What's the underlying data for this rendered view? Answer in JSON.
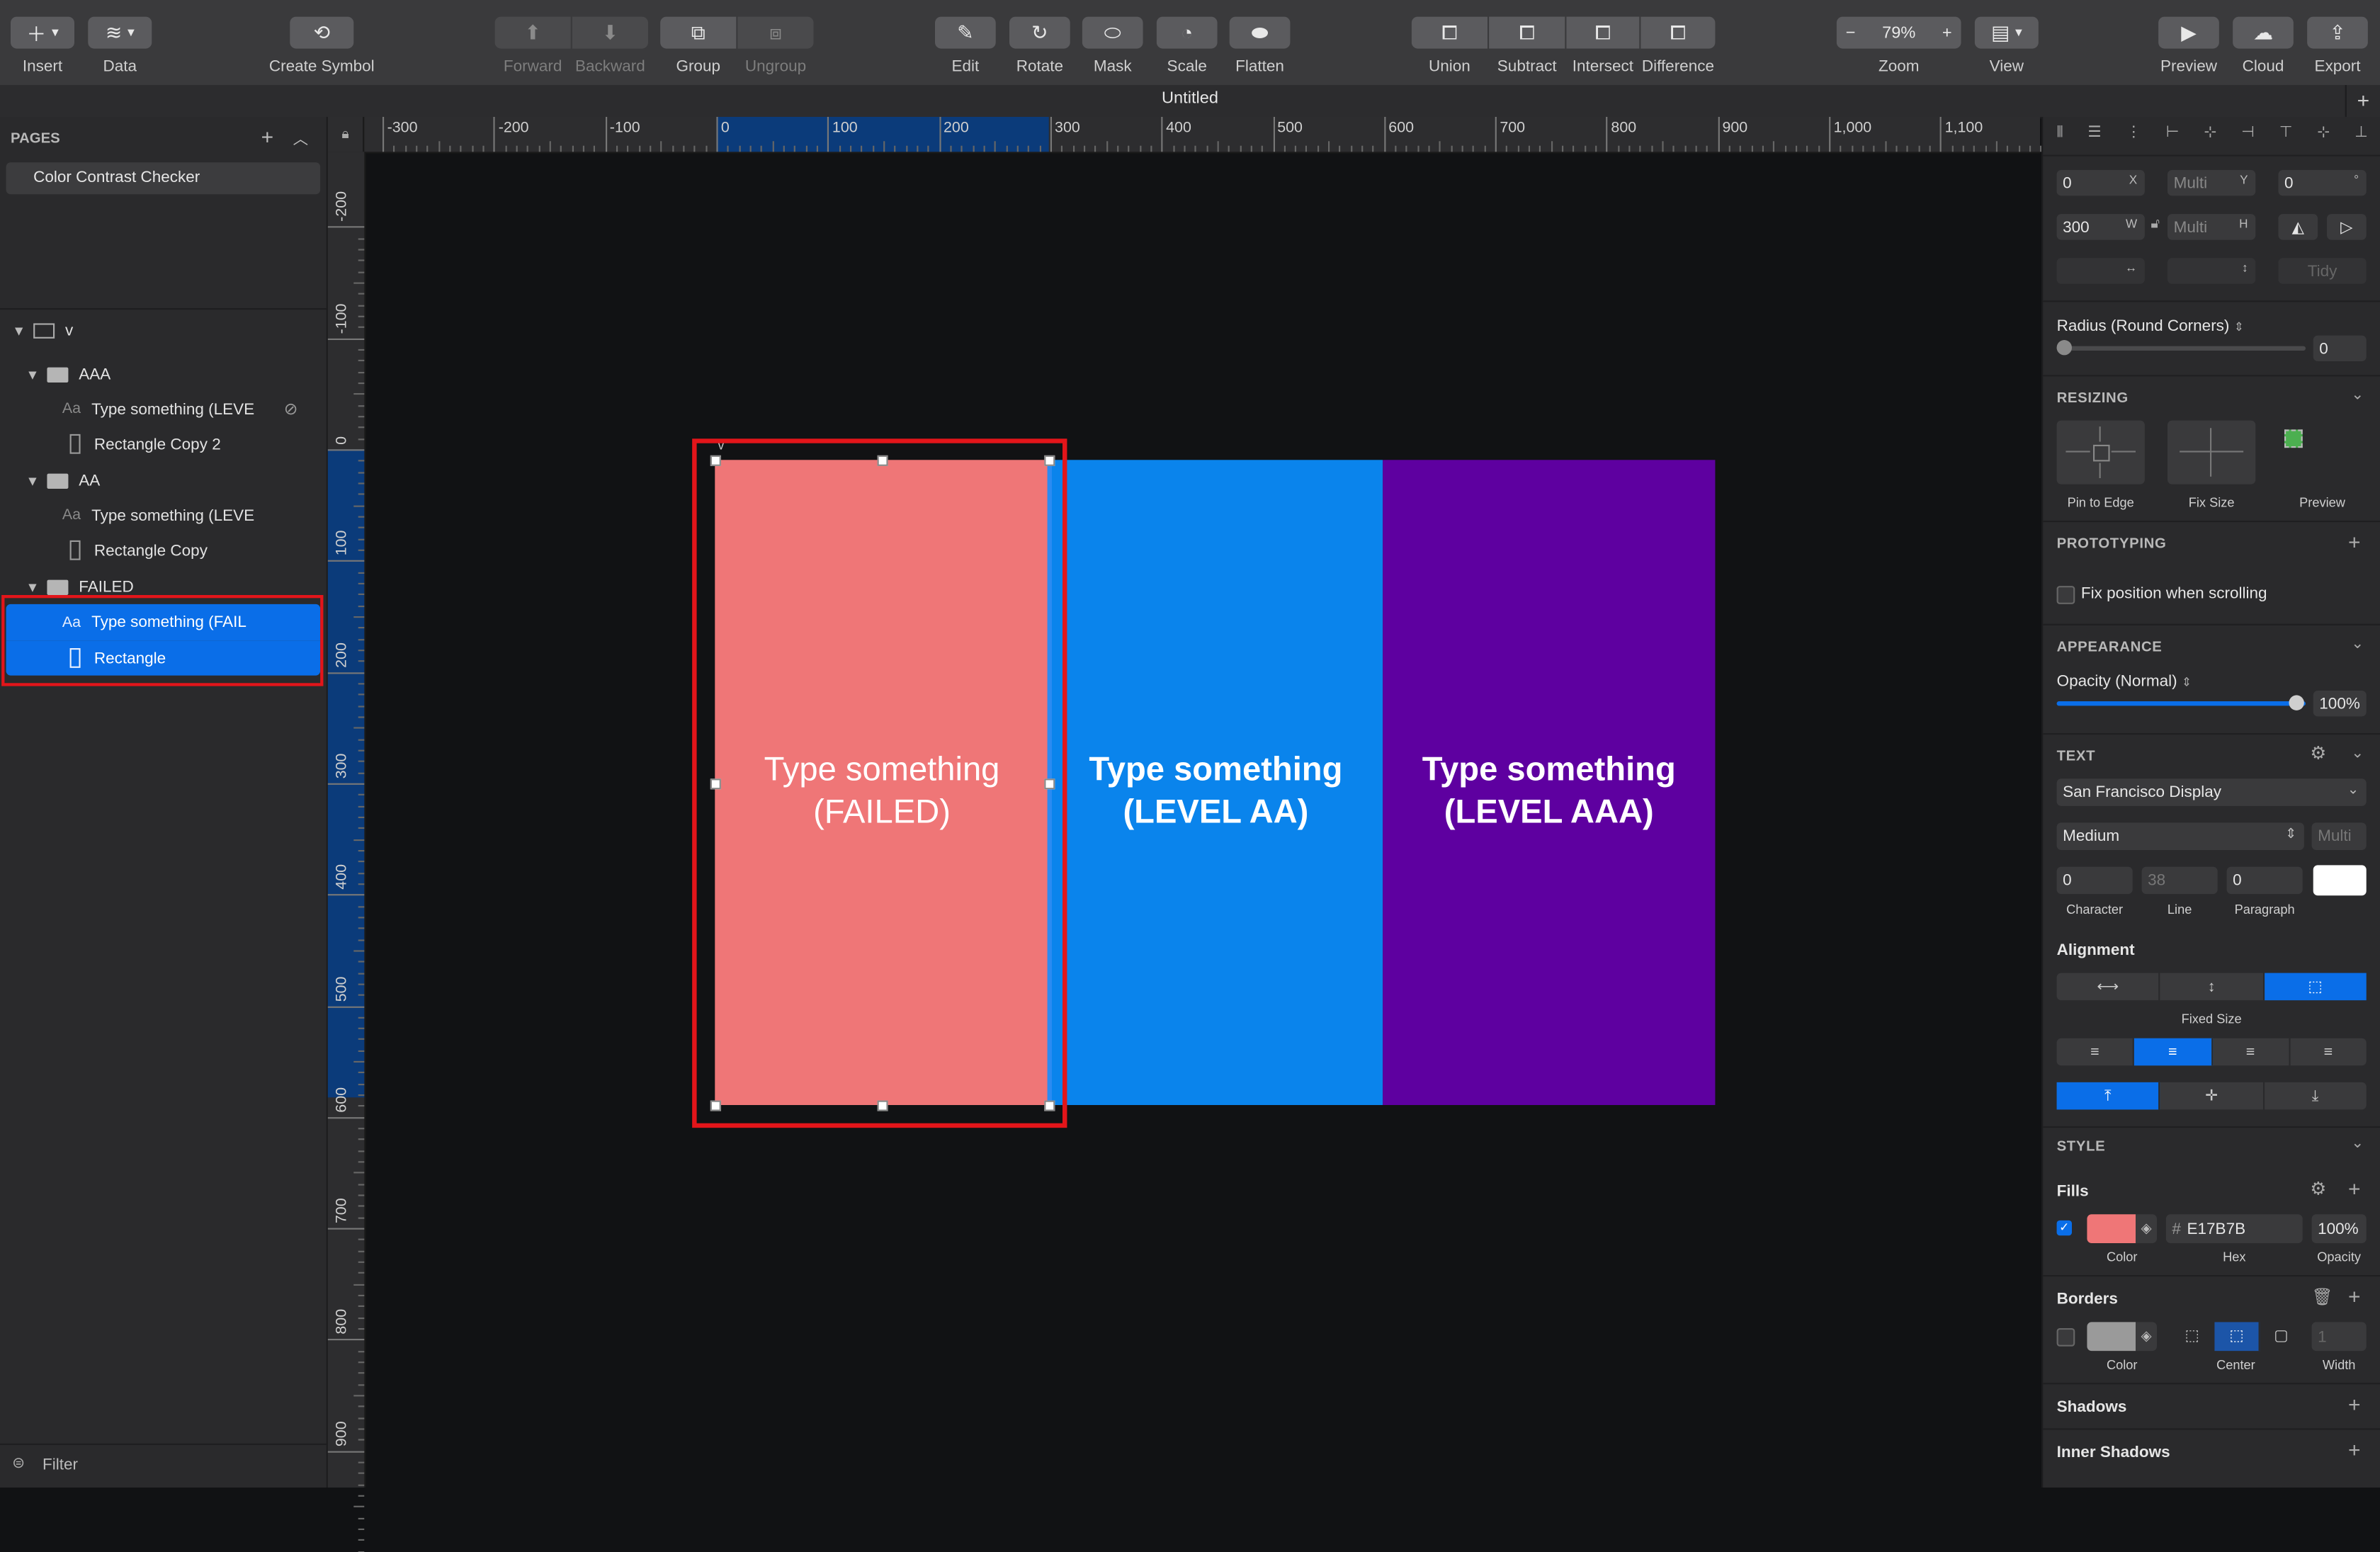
{
  "toolbar": {
    "insert": "Insert",
    "data": "Data",
    "create_symbol": "Create Symbol",
    "forward": "Forward",
    "backward": "Backward",
    "group": "Group",
    "ungroup": "Ungroup",
    "edit": "Edit",
    "rotate": "Rotate",
    "mask": "Mask",
    "scale": "Scale",
    "flatten": "Flatten",
    "union": "Union",
    "subtract": "Subtract",
    "intersect": "Intersect",
    "difference": "Difference",
    "zoom_label": "Zoom",
    "zoom_value": "79%",
    "view": "View",
    "preview": "Preview",
    "cloud": "Cloud",
    "export": "Export"
  },
  "document": {
    "title": "Untitled"
  },
  "pages": {
    "header": "PAGES",
    "items": [
      "Color Contrast Checker"
    ]
  },
  "layers": {
    "artboard": "v",
    "groups": [
      {
        "name": "AAA",
        "children": [
          "Type something (LEVE",
          "Rectangle Copy 2"
        ]
      },
      {
        "name": "AA",
        "children": [
          "Type something (LEVE",
          "Rectangle Copy"
        ]
      },
      {
        "name": "FAILED",
        "children": [
          "Type something (FAIL",
          "Rectangle"
        ]
      }
    ],
    "text_icon": "Aa",
    "filter": "Filter"
  },
  "ruler": {
    "top": [
      "-300",
      "-200",
      "-100",
      "0",
      "100",
      "200",
      "300",
      "400",
      "500",
      "600",
      "700",
      "800",
      "900",
      "1,000",
      "1,100"
    ],
    "left": [
      "-200",
      "-100",
      "0",
      "100",
      "200",
      "300",
      "400",
      "500",
      "600",
      "700",
      "800",
      "900"
    ]
  },
  "artboard": {
    "label": "v",
    "panels": [
      {
        "line1": "Type something",
        "line2": "(FAILED)",
        "bg": "#EF7677",
        "fg": "#FFFFFF"
      },
      {
        "line1": "Type something",
        "line2": "(LEVEL AA)",
        "bg": "#0A84EC",
        "fg": "#FFFFFF"
      },
      {
        "line1": "Type something",
        "line2": "(LEVEL AAA)",
        "bg": "#5E00A0",
        "fg": "#FFFFFF"
      }
    ]
  },
  "inspector": {
    "x": "0",
    "x_label": "X",
    "y": "Multi",
    "y_label": "Y",
    "rotation": "0",
    "rotation_label": "°",
    "w": "300",
    "w_label": "W",
    "h": "Multi",
    "h_label": "H",
    "tidy": "Tidy",
    "radius_label": "Radius (Round Corners)",
    "radius_value": "0",
    "resizing": "RESIZING",
    "pin_to_edge": "Pin to Edge",
    "fix_size": "Fix Size",
    "preview": "Preview",
    "prototyping": "PROTOTYPING",
    "fix_position": "Fix position when scrolling",
    "appearance": "APPEARANCE",
    "opacity_label": "Opacity (Normal)",
    "opacity_value": "100%",
    "text": "TEXT",
    "font_family": "San Francisco Display",
    "font_weight": "Medium",
    "font_size": "Multi",
    "character": "0",
    "line": "38",
    "paragraph": "0",
    "character_label": "Character",
    "line_label": "Line",
    "paragraph_label": "Paragraph",
    "alignment": "Alignment",
    "fixed_size": "Fixed Size",
    "style": "STYLE",
    "fills": "Fills",
    "fill_hex": "E17B7B",
    "fill_opacity": "100%",
    "color_label": "Color",
    "hex_label": "Hex",
    "opacity_caption": "Opacity",
    "borders": "Borders",
    "border_center": "Center",
    "border_width": "1",
    "width_label": "Width",
    "shadows": "Shadows",
    "inner_shadows": "Inner Shadows"
  }
}
